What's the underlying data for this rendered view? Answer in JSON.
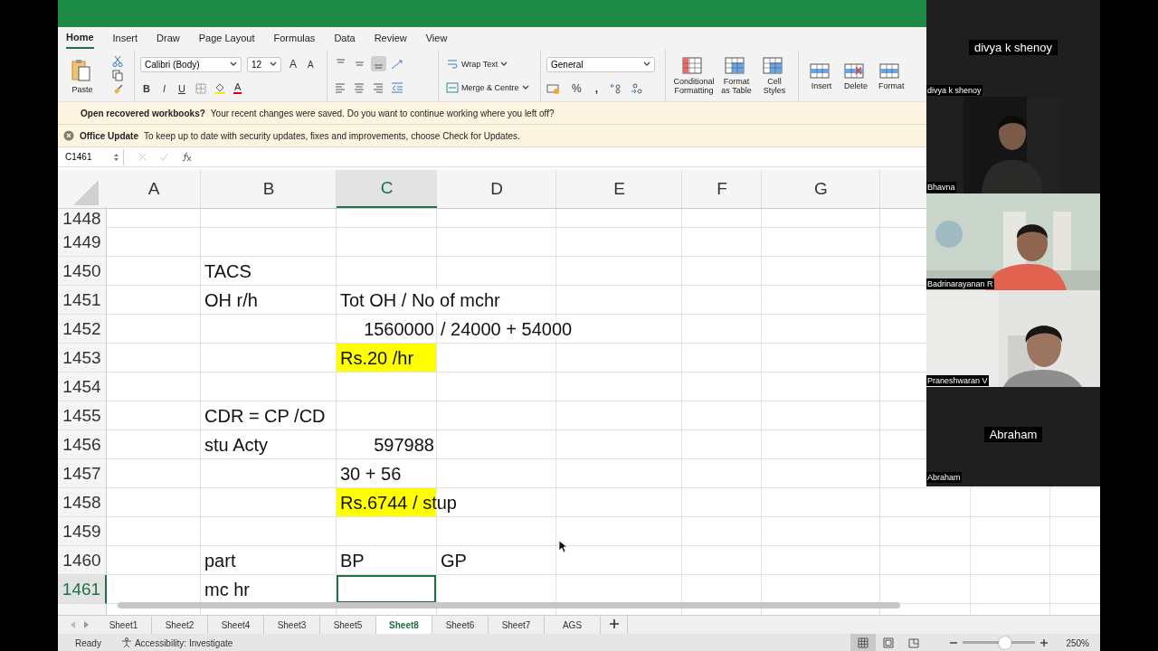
{
  "ribbon": {
    "tabs": [
      {
        "label": "Home",
        "selected": true
      },
      {
        "label": "Insert",
        "selected": false
      },
      {
        "label": "Draw",
        "selected": false
      },
      {
        "label": "Page Layout",
        "selected": false
      },
      {
        "label": "Formulas",
        "selected": false
      },
      {
        "label": "Data",
        "selected": false
      },
      {
        "label": "Review",
        "selected": false
      },
      {
        "label": "View",
        "selected": false
      }
    ],
    "paste": "Paste",
    "font": {
      "family": "Calibri (Body)",
      "size": "12",
      "grow_letter": "A",
      "shrink_letter": "A",
      "bold_letter": "B",
      "italic_letter": "I",
      "underline_letter": "U",
      "font_color_letter": "A"
    },
    "wrap_text": "Wrap Text",
    "merge": "Merge & Centre",
    "number": {
      "format": "General",
      "percent": "%",
      "comma": ","
    },
    "styles": [
      "Conditional Formatting",
      "Format as Table",
      "Cell Styles"
    ],
    "cells": [
      "Insert",
      "Delete",
      "Format"
    ]
  },
  "notifications": [
    {
      "kind": "recovery",
      "title": "Open recovered workbooks?",
      "message": "Your recent changes were saved. Do you want to continue working where you left off?"
    },
    {
      "kind": "update",
      "title": "Office Update",
      "message": "To keep up to date with security updates, fixes and improvements, choose Check for Updates."
    }
  ],
  "formula_bar": {
    "name_box": "C1461"
  },
  "columns": [
    {
      "label": "A",
      "selected": false
    },
    {
      "label": "B",
      "selected": false
    },
    {
      "label": "C",
      "selected": true
    },
    {
      "label": "D",
      "selected": false
    },
    {
      "label": "E",
      "selected": false
    },
    {
      "label": "F",
      "selected": false
    },
    {
      "label": "G",
      "selected": false
    }
  ],
  "rows": [
    {
      "number": "1448",
      "selected": false,
      "cells": []
    },
    {
      "number": "1449",
      "selected": false,
      "cells": []
    },
    {
      "number": "1450",
      "selected": false,
      "cells": [
        {
          "kind": "empty"
        },
        {
          "kind": "text",
          "text": "TACS"
        }
      ]
    },
    {
      "number": "1451",
      "selected": false,
      "cells": [
        {
          "kind": "empty"
        },
        {
          "kind": "text",
          "text": "OH r/h"
        },
        {
          "kind": "text",
          "text": "Tot OH / No of mchr"
        }
      ]
    },
    {
      "number": "1452",
      "selected": false,
      "cells": [
        {
          "kind": "empty"
        },
        {
          "kind": "empty"
        },
        {
          "kind": "number",
          "text": "1560000"
        },
        {
          "kind": "text",
          "text": "/ 24000 + 54000"
        }
      ]
    },
    {
      "number": "1453",
      "selected": false,
      "cells": [
        {
          "kind": "empty"
        },
        {
          "kind": "empty"
        },
        {
          "kind": "text",
          "text": "Rs.20 /hr",
          "highlight": true
        }
      ]
    },
    {
      "number": "1454",
      "selected": false,
      "cells": []
    },
    {
      "number": "1455",
      "selected": false,
      "cells": [
        {
          "kind": "empty"
        },
        {
          "kind": "text",
          "text": "CDR = CP /CD"
        }
      ]
    },
    {
      "number": "1456",
      "selected": false,
      "cells": [
        {
          "kind": "empty"
        },
        {
          "kind": "text",
          "text": "stu Acty"
        },
        {
          "kind": "number",
          "text": "597988"
        }
      ]
    },
    {
      "number": "1457",
      "selected": false,
      "cells": [
        {
          "kind": "empty"
        },
        {
          "kind": "empty"
        },
        {
          "kind": "text",
          "text": "30 + 56"
        }
      ]
    },
    {
      "number": "1458",
      "selected": false,
      "cells": [
        {
          "kind": "empty"
        },
        {
          "kind": "empty"
        },
        {
          "kind": "text",
          "text": "Rs.6744 / stup",
          "highlight": true
        }
      ]
    },
    {
      "number": "1459",
      "selected": false,
      "cells": []
    },
    {
      "number": "1460",
      "selected": false,
      "cells": [
        {
          "kind": "empty"
        },
        {
          "kind": "text",
          "text": "part"
        },
        {
          "kind": "text",
          "text": "BP"
        },
        {
          "kind": "text",
          "text": "GP"
        }
      ]
    },
    {
      "number": "1461",
      "selected": true,
      "cells": [
        {
          "kind": "empty"
        },
        {
          "kind": "text",
          "text": "mc hr"
        },
        {
          "kind": "empty",
          "selected": true
        }
      ]
    }
  ],
  "sheet_tabs": [
    {
      "label": "Sheet1",
      "selected": false
    },
    {
      "label": "Sheet2",
      "selected": false
    },
    {
      "label": "Sheet4",
      "selected": false
    },
    {
      "label": "Sheet3",
      "selected": false
    },
    {
      "label": "Sheet5",
      "selected": false
    },
    {
      "label": "Sheet8",
      "selected": true
    },
    {
      "label": "Sheet6",
      "selected": false
    },
    {
      "label": "Sheet7",
      "selected": false
    },
    {
      "label": "AGS",
      "selected": false
    }
  ],
  "status_bar": {
    "state": "Ready",
    "accessibility": "Accessibility: Investigate",
    "views": [
      {
        "kind": "normal",
        "selected": true
      },
      {
        "kind": "page-layout",
        "selected": false
      },
      {
        "kind": "page-break",
        "selected": false
      }
    ],
    "zoom": {
      "level": 0.6
    },
    "zoom_text": "250%"
  },
  "participants": [
    {
      "kind": "name",
      "center_name": "divya k shenoy",
      "label": "divya k shenoy"
    },
    {
      "kind": "camera",
      "label": "Bhavna"
    },
    {
      "kind": "camera",
      "label": "Badrinarayanan R"
    },
    {
      "kind": "camera",
      "label": "Praneshwaran V"
    },
    {
      "kind": "name",
      "center_name": "Abraham",
      "label": "Abraham"
    }
  ]
}
